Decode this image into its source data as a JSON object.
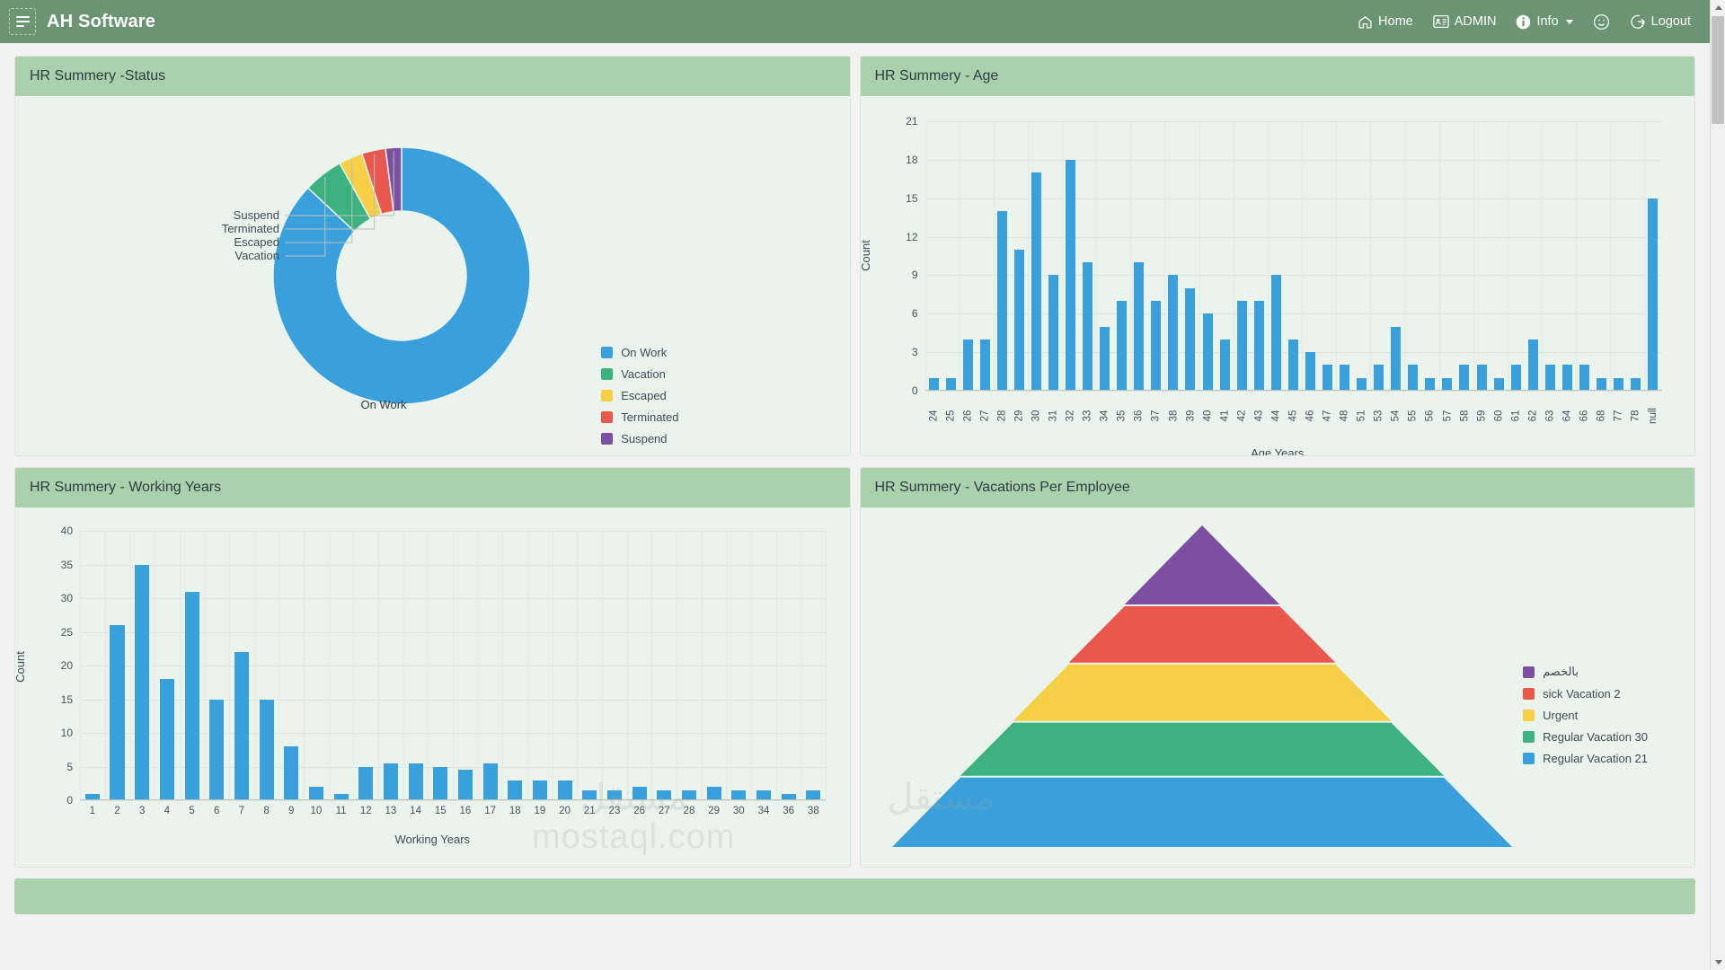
{
  "navbar": {
    "brand": "AH Software",
    "menu_icon": "hamburger-icon",
    "items": [
      {
        "label": "Home",
        "icon": "home-icon"
      },
      {
        "label": "ADMIN",
        "icon": "id-card-icon"
      },
      {
        "label": "Info",
        "icon": "info-circle-icon",
        "has_caret": true
      },
      {
        "label": "",
        "icon": "smiley-face-icon"
      },
      {
        "label": "Logout",
        "icon": "logout-arrow-icon"
      }
    ],
    "background_color": "#6a9472"
  },
  "cards": {
    "status": {
      "title": "HR Summery -Status"
    },
    "age": {
      "title": "HR Summery - Age"
    },
    "working": {
      "title": "HR Summery - Working Years"
    },
    "vacations": {
      "title": "HR Summery - Vacations Per Employee"
    },
    "header_color": "#abd0ad",
    "body_color": "#eaf3ec"
  },
  "watermark": {
    "arabic": "مستقل",
    "latin": "mostaql.com"
  },
  "chart_data": [
    {
      "type": "pie",
      "id": "hr-status-donut",
      "title": "HR Summery -Status",
      "donut": true,
      "center_label": "On Work",
      "legend_position": "right",
      "labels": [
        "On Work",
        "Vacation",
        "Escaped",
        "Terminated",
        "Suspend"
      ],
      "values": [
        87,
        5,
        3,
        3,
        2
      ],
      "colors": [
        "#3aa0dc",
        "#3cb37e",
        "#f7cf46",
        "#e8584f",
        "#7d4fa3"
      ],
      "callouts": [
        "Suspend",
        "Terminated",
        "Escaped",
        "Vacation"
      ]
    },
    {
      "type": "bar",
      "id": "hr-age-bars",
      "title": "HR Summery - Age",
      "xlabel": "Age Years",
      "ylabel": "Count",
      "ylim": [
        0,
        21
      ],
      "yticks": [
        0,
        3,
        6,
        9,
        12,
        15,
        18,
        21
      ],
      "grid": true,
      "bar_color": "#3aa0dc",
      "categories": [
        "24",
        "25",
        "26",
        "27",
        "28",
        "29",
        "30",
        "31",
        "32",
        "33",
        "34",
        "35",
        "36",
        "37",
        "38",
        "39",
        "40",
        "41",
        "42",
        "43",
        "44",
        "45",
        "46",
        "47",
        "48",
        "51",
        "53",
        "54",
        "55",
        "56",
        "57",
        "58",
        "59",
        "60",
        "61",
        "62",
        "63",
        "64",
        "66",
        "68",
        "77",
        "78",
        "null"
      ],
      "values": [
        1,
        1,
        4,
        4,
        14,
        11,
        17,
        9,
        18,
        10,
        5,
        7,
        10,
        7,
        9,
        8,
        6,
        4,
        7,
        7,
        9,
        4,
        3,
        2,
        2,
        1,
        2,
        5,
        2,
        1,
        1,
        2,
        2,
        1,
        2,
        4,
        2,
        2,
        2,
        1,
        1,
        1,
        15
      ]
    },
    {
      "type": "bar",
      "id": "hr-working-years-bars",
      "title": "HR Summery - Working Years",
      "xlabel": "Working Years",
      "ylabel": "Count",
      "ylim": [
        0,
        40
      ],
      "yticks": [
        0,
        5,
        10,
        15,
        20,
        25,
        30,
        35,
        40
      ],
      "grid": true,
      "bar_color": "#3aa0dc",
      "categories": [
        "1",
        "2",
        "3",
        "4",
        "5",
        "6",
        "7",
        "8",
        "9",
        "10",
        "11",
        "12",
        "13",
        "14",
        "15",
        "16",
        "17",
        "18",
        "19",
        "20",
        "21",
        "23",
        "26",
        "27",
        "28",
        "29",
        "30",
        "34",
        "36",
        "38"
      ],
      "values": [
        1,
        26,
        35,
        18,
        31,
        15,
        22,
        15,
        8,
        2,
        1,
        5,
        5.5,
        5.5,
        5,
        4.5,
        5.5,
        3,
        3,
        3,
        1.5,
        1.5,
        2,
        1.5,
        1.5,
        2,
        1.5,
        1.5,
        1,
        1.5
      ]
    },
    {
      "type": "pie",
      "id": "hr-vacations-pyramid",
      "title": "HR Summery - Vacations Per Employee",
      "shape": "pyramid",
      "legend_position": "right",
      "labels": [
        "بالخصم",
        "sick Vacation 2",
        "Urgent",
        "Regular Vacation 30",
        "Regular Vacation 21"
      ],
      "colors": [
        "#7d4fa3",
        "#e8584f",
        "#f7cf46",
        "#3cb37e",
        "#3aa0dc"
      ],
      "band_fractions": [
        0.25,
        0.18,
        0.18,
        0.17,
        0.22
      ]
    }
  ]
}
